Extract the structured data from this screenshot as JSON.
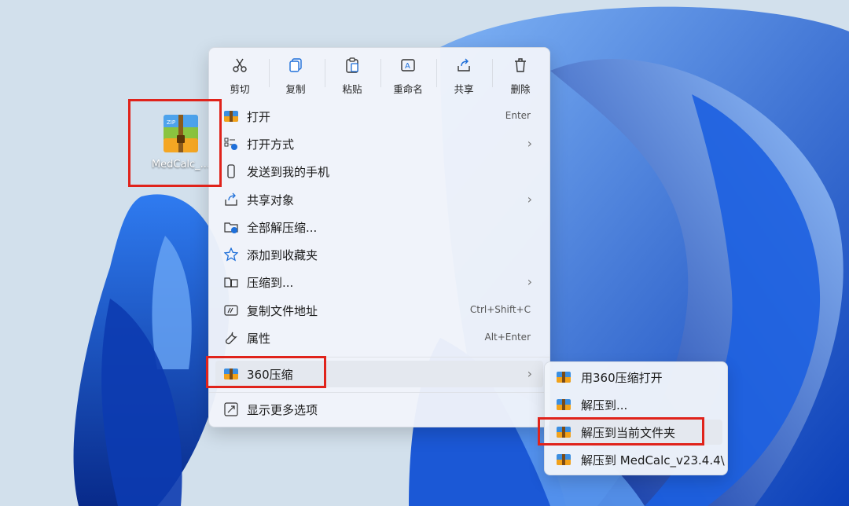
{
  "desktop": {
    "file_name": "MedCalc_..."
  },
  "toolbar": {
    "cut": "剪切",
    "copy": "复制",
    "paste": "粘贴",
    "rename": "重命名",
    "share": "共享",
    "delete": "删除"
  },
  "menu": {
    "open": {
      "label": "打开",
      "shortcut": "Enter"
    },
    "open_with": {
      "label": "打开方式"
    },
    "send_phone": {
      "label": "发送到我的手机"
    },
    "share_object": {
      "label": "共享对象"
    },
    "extract_all": {
      "label": "全部解压缩..."
    },
    "add_favorites": {
      "label": "添加到收藏夹"
    },
    "compress_to": {
      "label": "压缩到..."
    },
    "copy_path": {
      "label": "复制文件地址",
      "shortcut": "Ctrl+Shift+C"
    },
    "properties": {
      "label": "属性",
      "shortcut": "Alt+Enter"
    },
    "zip360": {
      "label": "360压缩"
    },
    "more_options": {
      "label": "显示更多选项"
    }
  },
  "submenu": {
    "open_with_360": "用360压缩打开",
    "extract_to": "解压到...",
    "extract_here": "解压到当前文件夹",
    "extract_to_folder": "解压到 MedCalc_v23.4.4\\"
  },
  "colors": {
    "accent": "#1e6fd9",
    "highlight_box": "#e0231b",
    "menu_bg": "#f0f4fa"
  },
  "icons": {
    "cut": "scissors-icon",
    "copy": "copy-icon",
    "paste": "paste-icon",
    "rename": "rename-icon",
    "share": "share-icon",
    "delete": "trash-icon"
  }
}
